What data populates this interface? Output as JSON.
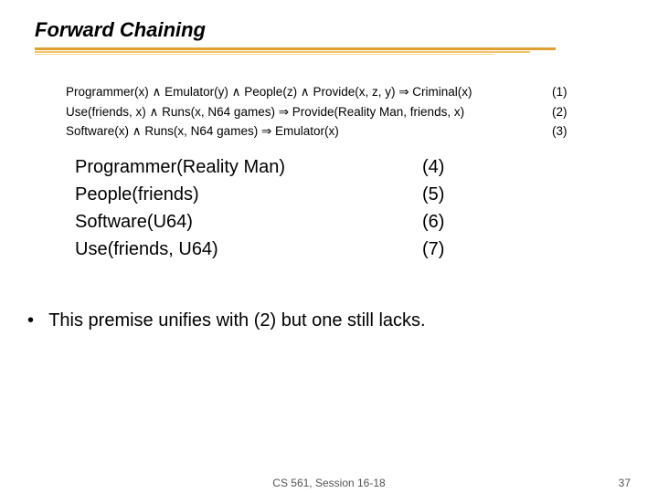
{
  "title": "Forward Chaining",
  "rules": [
    {
      "text": "Programmer(x) ∧ Emulator(y) ∧ People(z) ∧ Provide(x, z, y) ⇒ Criminal(x)",
      "num": "(1)"
    },
    {
      "text": "Use(friends, x) ∧ Runs(x, N64 games) ⇒ Provide(Reality Man, friends, x)",
      "num": "(2)"
    },
    {
      "text": "Software(x) ∧ Runs(x, N64 games) ⇒ Emulator(x)",
      "num": "(3)"
    }
  ],
  "facts": [
    {
      "text": "Programmer(Reality Man)",
      "num": "(4)"
    },
    {
      "text": "People(friends)",
      "num": "(5)"
    },
    {
      "text": "Software(U64)",
      "num": "(6)"
    },
    {
      "text": "Use(friends, U64)",
      "num": "(7)"
    }
  ],
  "bullet": "This premise unifies with (2) but one still lacks.",
  "footer_center": "CS 561, Session 16-18",
  "footer_right": "37"
}
